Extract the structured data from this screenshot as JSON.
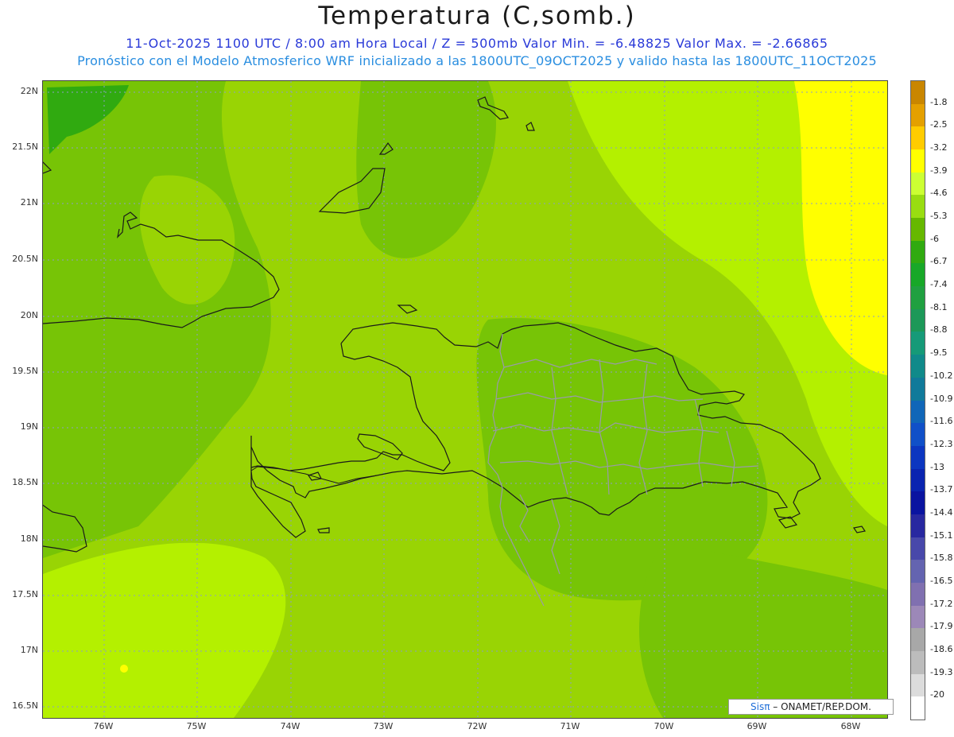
{
  "header": {
    "title": "Temperatura (C,somb.)",
    "subtitle1": "11-Oct-2025  1100 UTC / 8:00 am Hora Local / Z = 500mb  Valor Min. = -6.48825  Valor Max. = -2.66865",
    "subtitle2": "Pronóstico con el Modelo Atmosferico WRF inicializado a las 1800UTC_09OCT2025 y valido hasta las  1800UTC_11OCT2025"
  },
  "axes": {
    "lat_labels": [
      "22N",
      "21.5N",
      "21N",
      "20.5N",
      "20N",
      "19.5N",
      "19N",
      "18.5N",
      "18N",
      "17.5N",
      "17N",
      "16.5N"
    ],
    "lon_labels": [
      "76W",
      "75W",
      "74W",
      "73W",
      "72W",
      "71W",
      "70W",
      "69W",
      "68W"
    ]
  },
  "colorbar": {
    "labels": [
      "-1.8",
      "-2.5",
      "-3.2",
      "-3.9",
      "-4.6",
      "-5.3",
      "-6",
      "-6.7",
      "-7.4",
      "-8.1",
      "-8.8",
      "-9.5",
      "-10.2",
      "-10.9",
      "-11.6",
      "-12.3",
      "-13",
      "-13.7",
      "-14.4",
      "-15.1",
      "-15.8",
      "-16.5",
      "-17.2",
      "-17.9",
      "-18.6",
      "-19.3",
      "-20"
    ],
    "colors": [
      "#c98600",
      "#e4a000",
      "#ffcc00",
      "#ffff00",
      "#ccff33",
      "#99dd11",
      "#66b800",
      "#30aa10",
      "#18a828",
      "#20a040",
      "#1c9858",
      "#169a78",
      "#108a8a",
      "#107a9a",
      "#1066b8",
      "#1050c8",
      "#0c36c0",
      "#0a24b0",
      "#0a14a0",
      "#2828a0",
      "#4848aa",
      "#6464b0",
      "#8070b0",
      "#9c88b8",
      "#a8a8a8",
      "#bcbcbc",
      "#dcdcdc",
      "#ffffff"
    ]
  },
  "map": {
    "field_colors": {
      "dark_green": "#30aa10",
      "mid_green": "#77c406",
      "light_green": "#99d404",
      "yellow_green": "#b4f000",
      "yellow": "#ffff00"
    }
  },
  "credit": {
    "logo": "Sisπ",
    "text": "– ONAMET/REP.DOM."
  }
}
